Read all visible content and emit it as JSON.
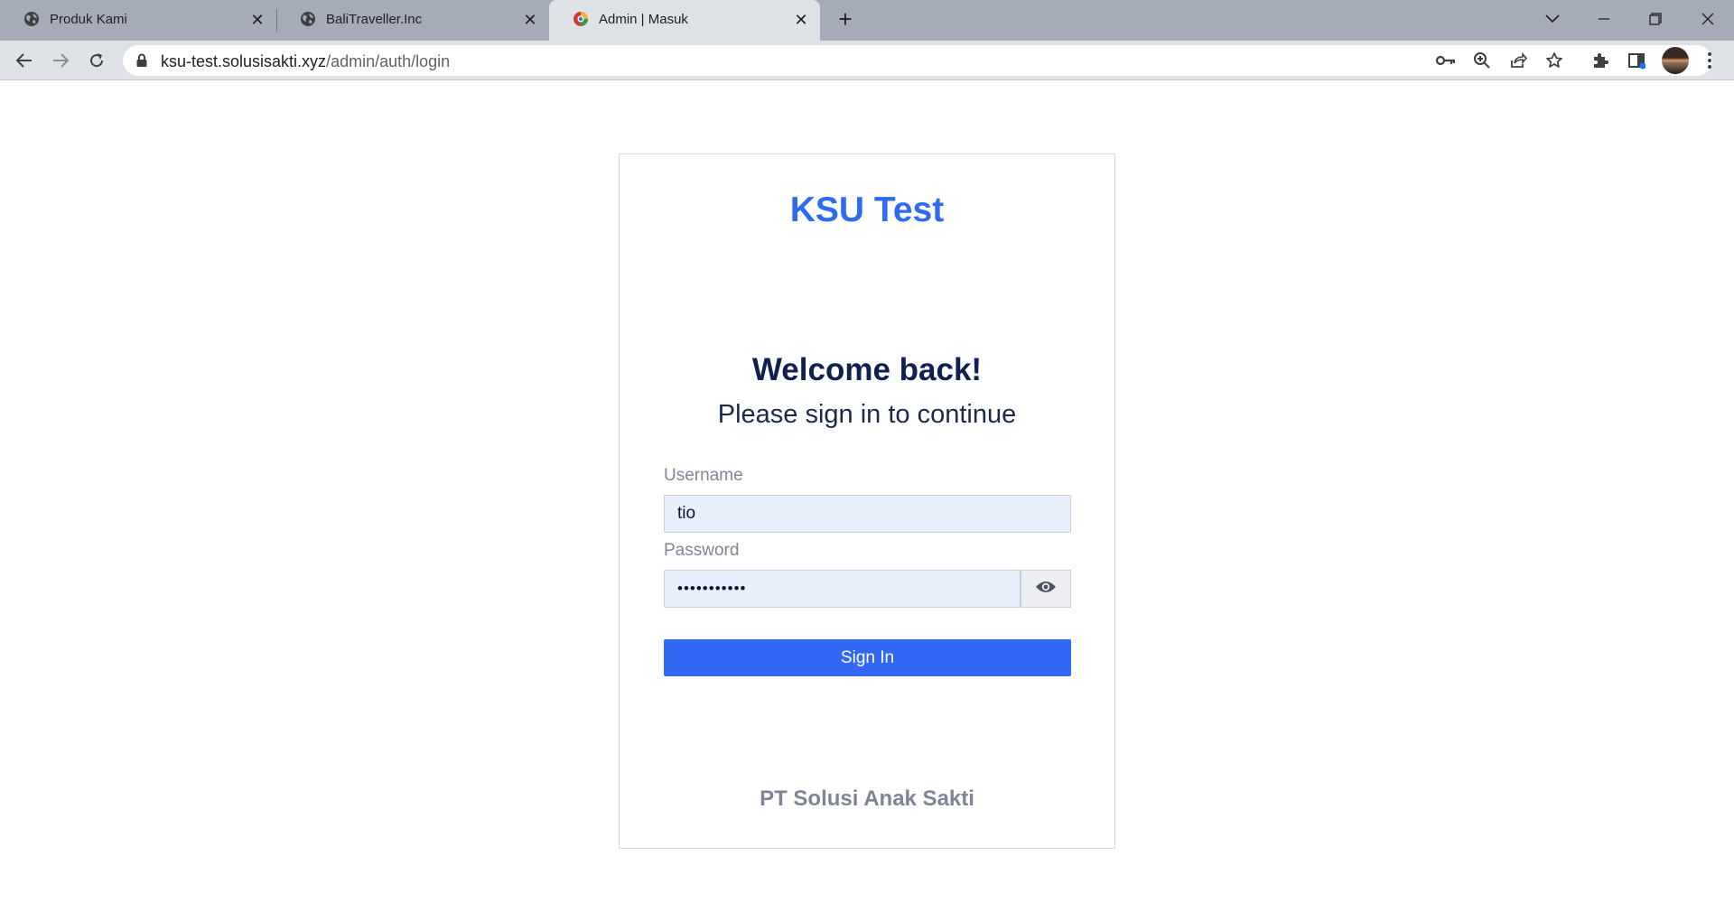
{
  "browser": {
    "tabs": [
      {
        "title": "Produk Kami",
        "favicon": "globe-icon",
        "active": false
      },
      {
        "title": "BaliTraveller.Inc",
        "favicon": "globe-icon",
        "active": false
      },
      {
        "title": "Admin | Masuk",
        "favicon": "app-logo-icon",
        "active": true
      }
    ],
    "tab_close_glyph": "✕",
    "new_tab_glyph": "+",
    "url_host": "ksu-test.solusisakti.xyz",
    "url_path": "/admin/auth/login"
  },
  "login": {
    "brand": "KSU Test",
    "heading": "Welcome back!",
    "subheading": "Please sign in to continue",
    "username_label": "Username",
    "username_value": "tio",
    "password_label": "Password",
    "password_value": "•••••••••••",
    "signin_label": "Sign In",
    "footer": "PT Solusi Anak Sakti"
  },
  "colors": {
    "brand": "#2e6bf0",
    "button": "#3367f6",
    "input_fill": "#e8f0fe",
    "heading": "#0f2150",
    "muted": "#7d8597"
  }
}
